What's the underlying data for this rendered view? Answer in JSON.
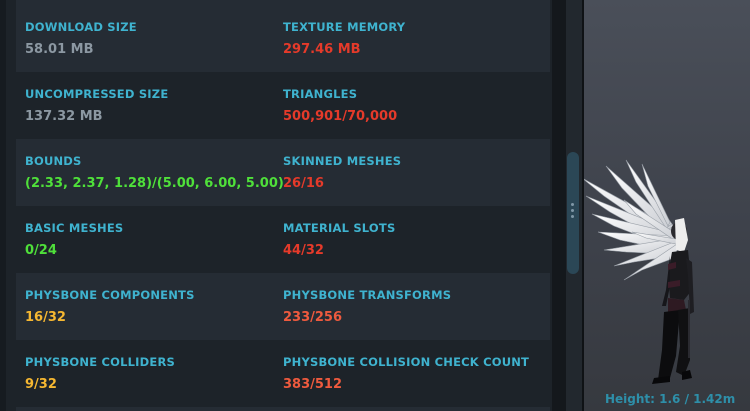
{
  "colors": {
    "label": "#3fb3cf",
    "neutral": "#8c98a2",
    "red": "#e53a2a",
    "orange_red": "#ee5a3e",
    "green": "#4fe03a",
    "yellow": "#f5b731",
    "height_label": "#2e8fa9"
  },
  "stats": [
    {
      "left": {
        "label": "DOWNLOAD SIZE",
        "value": "58.01 MB",
        "color": "#8c98a2"
      },
      "right": {
        "label": "TEXTURE MEMORY",
        "value": "297.46 MB",
        "color": "#e53a2a"
      }
    },
    {
      "left": {
        "label": "UNCOMPRESSED SIZE",
        "value": "137.32 MB",
        "color": "#8c98a2"
      },
      "right": {
        "label": "TRIANGLES",
        "value": "500,901/70,000",
        "color": "#e53a2a"
      }
    },
    {
      "left": {
        "label": "BOUNDS",
        "value": "(2.33, 2.37, 1.28)/(5.00, 6.00, 5.00)",
        "color": "#4fe03a"
      },
      "right": {
        "label": "SKINNED MESHES",
        "value": "26/16",
        "color": "#e53a2a"
      }
    },
    {
      "left": {
        "label": "BASIC MESHES",
        "value": "0/24",
        "color": "#4fe03a"
      },
      "right": {
        "label": "MATERIAL SLOTS",
        "value": "44/32",
        "color": "#e53a2a"
      }
    },
    {
      "left": {
        "label": "PHYSBONE COMPONENTS",
        "value": "16/32",
        "color": "#f5b731"
      },
      "right": {
        "label": "PHYSBONE TRANSFORMS",
        "value": "233/256",
        "color": "#ee5a3e"
      }
    },
    {
      "left": {
        "label": "PHYSBONE COLLIDERS",
        "value": "9/32",
        "color": "#f5b731"
      },
      "right": {
        "label": "PHYSBONE COLLISION CHECK COUNT",
        "value": "383/512",
        "color": "#ee5a3e"
      }
    }
  ],
  "viewport": {
    "height_text": "Height: 1.6 / 1.42m"
  }
}
